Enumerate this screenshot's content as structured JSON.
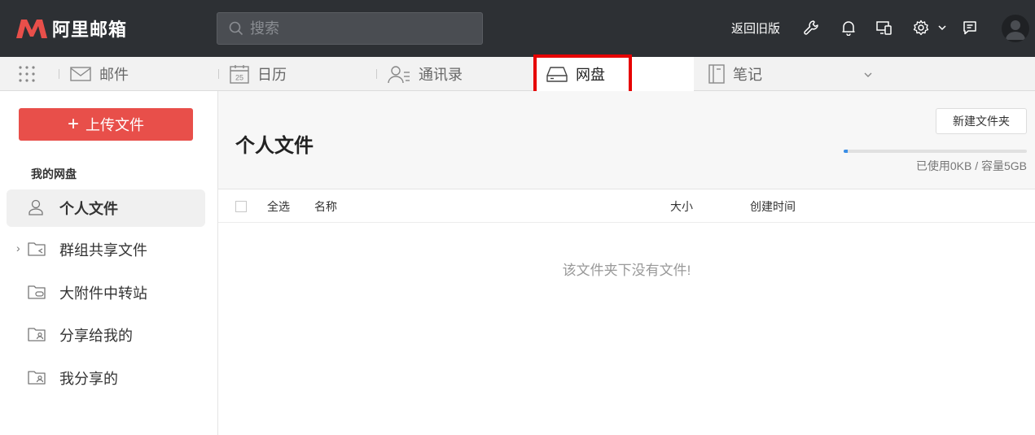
{
  "app": {
    "name": "阿里邮箱",
    "brand_color": "#e84f4a"
  },
  "header": {
    "search_placeholder": "搜索",
    "old_version_label": "返回旧版",
    "icons": [
      "wrench-icon",
      "bell-icon",
      "device-icon",
      "gear-icon",
      "chevron-down-icon",
      "message-icon",
      "avatar-icon"
    ]
  },
  "tabs": [
    {
      "label": "邮件",
      "icon": "mail-icon"
    },
    {
      "label": "日历",
      "icon": "calendar-icon",
      "icon_text": "25"
    },
    {
      "label": "通讯录",
      "icon": "contacts-icon"
    },
    {
      "label": "网盘",
      "icon": "drive-icon",
      "active": true
    },
    {
      "label": "笔记",
      "icon": "notebook-icon"
    }
  ],
  "sidebar": {
    "upload_label": "上传文件",
    "section_label": "我的网盘",
    "items": [
      {
        "label": "个人文件",
        "icon": "user-icon",
        "active": true
      },
      {
        "label": "群组共享文件",
        "icon": "shared-folder-icon",
        "expandable": true
      },
      {
        "label": "大附件中转站",
        "icon": "attachment-folder-icon"
      },
      {
        "label": "分享给我的",
        "icon": "user-folder-icon"
      },
      {
        "label": "我分享的",
        "icon": "user-folder-icon"
      }
    ]
  },
  "main": {
    "title": "个人文件",
    "new_folder_label": "新建文件夹",
    "storage": {
      "used_fraction": 0.0,
      "text": "已使用0KB / 容量5GB"
    },
    "columns": {
      "select_all": "全选",
      "name": "名称",
      "size": "大小",
      "created": "创建时间"
    },
    "empty_message": "该文件夹下没有文件!"
  },
  "highlight_color": "#e60000"
}
